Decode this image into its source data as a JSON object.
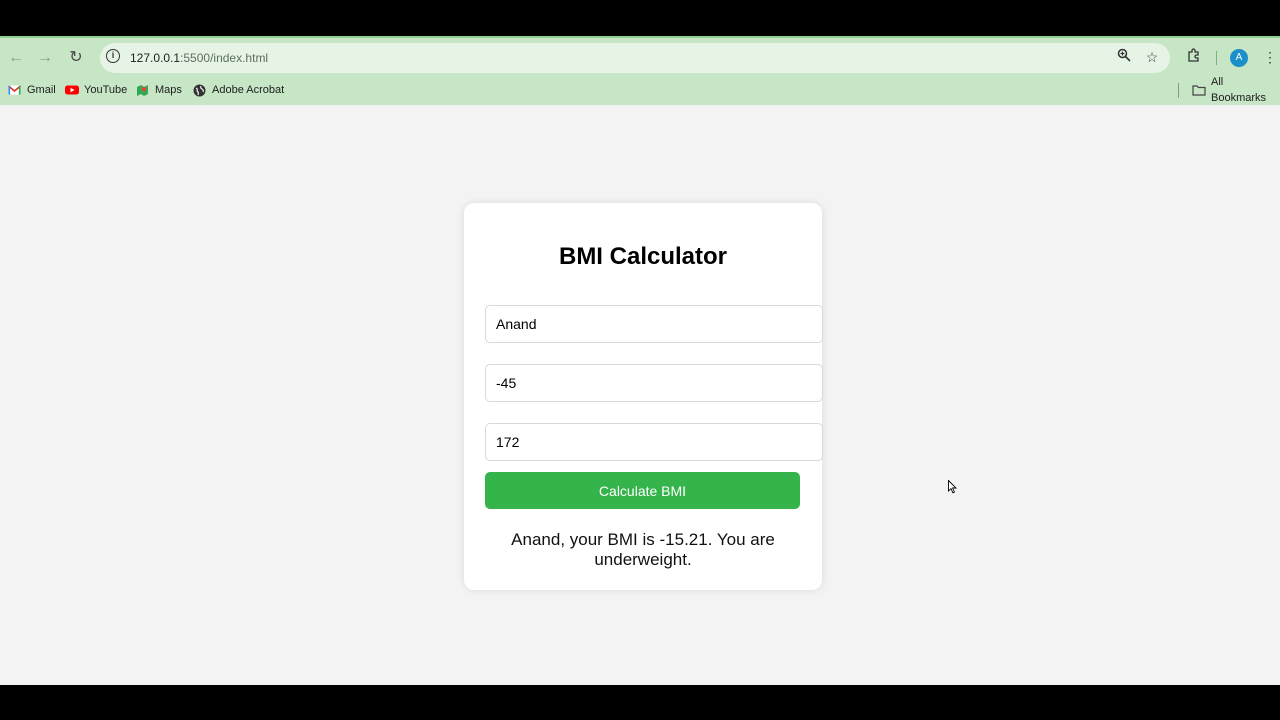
{
  "browser": {
    "url_host": "127.0.0.1",
    "url_rest": ":5500/index.html",
    "avatar_letter": "A",
    "icons": [
      "back-icon",
      "forward-icon",
      "reload-icon",
      "site-info-icon",
      "zoom-icon",
      "star-icon",
      "extensions-icon",
      "menu-icon"
    ]
  },
  "bookmarks": {
    "items": [
      {
        "label": "Gmail",
        "icon": "gmail-icon"
      },
      {
        "label": "YouTube",
        "icon": "youtube-icon"
      },
      {
        "label": "Maps",
        "icon": "maps-icon"
      },
      {
        "label": "Adobe Acrobat",
        "icon": "globe-icon"
      }
    ],
    "all_bookmarks": "All Bookmarks"
  },
  "app": {
    "title": "BMI Calculator",
    "name_value": "Anand",
    "weight_value": "-45",
    "height_value": "172",
    "button_label": "Calculate BMI",
    "result": "Anand, your BMI is -15.21. You are underweight."
  },
  "colors": {
    "button": "#34b44a",
    "toolbar": "#c6e6c6",
    "page_bg": "#f3f3f3"
  }
}
